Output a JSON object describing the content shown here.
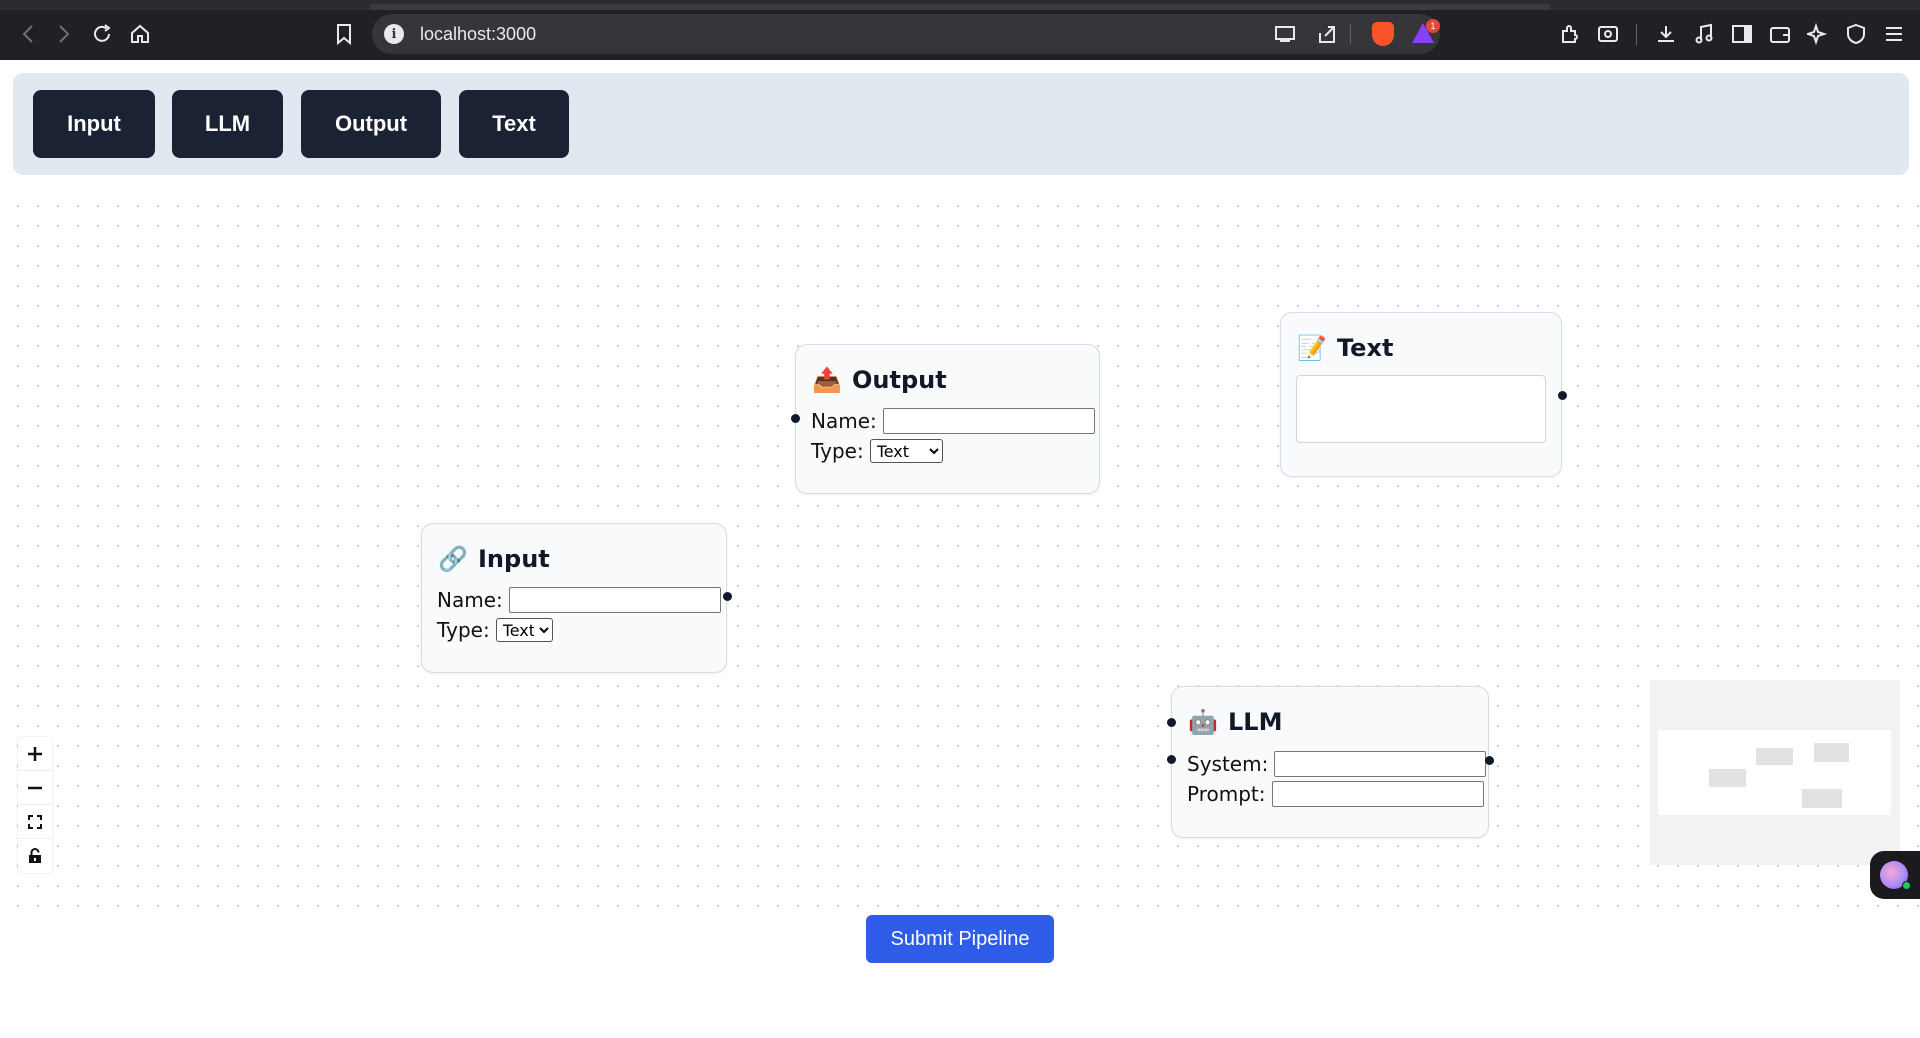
{
  "browser": {
    "url": "localhost:3000",
    "notification_count": "1",
    "icons": [
      "back-icon",
      "forward-icon",
      "reload-icon",
      "home-icon",
      "bookmark-icon",
      "info-icon",
      "cast-icon",
      "share-icon",
      "brave-shields-icon",
      "brave-rewards-icon",
      "extensions-icon",
      "screenshot-icon",
      "download-icon",
      "media-icon",
      "sidebar-icon",
      "wallet-icon",
      "leo-icon",
      "vpn-icon",
      "menu-icon"
    ]
  },
  "toolbar": {
    "buttons": [
      {
        "label": "Input"
      },
      {
        "label": "LLM"
      },
      {
        "label": "Output"
      },
      {
        "label": "Text"
      }
    ]
  },
  "nodes": {
    "output": {
      "title": "Output",
      "icon": "📤",
      "name_label": "Name:",
      "name_value": "",
      "type_label": "Type:",
      "type_value": "Text"
    },
    "text": {
      "title": "Text",
      "icon": "📝",
      "value": ""
    },
    "input": {
      "title": "Input",
      "icon": "🔗",
      "name_label": "Name:",
      "name_value": "",
      "type_label": "Type:",
      "type_value": "Text"
    },
    "llm": {
      "title": "LLM",
      "icon": "🤖",
      "system_label": "System:",
      "system_value": "",
      "prompt_label": "Prompt:",
      "prompt_value": ""
    }
  },
  "controls": [
    "zoom-in",
    "zoom-out",
    "fit-view",
    "lock"
  ],
  "submit": {
    "label": "Submit Pipeline"
  },
  "colors": {
    "toolbar_bg": "#e2e8f0",
    "tool_button_bg": "#1a2233",
    "submit_bg": "#2f5ce8",
    "node_bg": "#f8fafc",
    "handle": "#111827"
  }
}
